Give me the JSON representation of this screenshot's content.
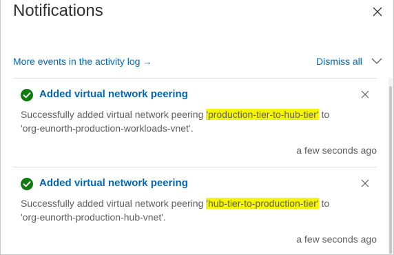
{
  "panel": {
    "title": "Notifications",
    "activity_log_link": "More events in the activity log",
    "activity_log_arrow": "→",
    "dismiss_all": "Dismiss all"
  },
  "colors": {
    "link": "#0067b8",
    "success": "#107c10",
    "highlight": "#f5f500"
  },
  "notifications": [
    {
      "icon": "success-check-icon",
      "title": "Added virtual network peering",
      "body_prefix": "Successfully added virtual network peering ",
      "peering_name": "'production-tier-to-hub-tier'",
      "body_middle": " to",
      "target_vnet": "'org-eunorth-production-workloads-vnet'.",
      "time": "a few seconds ago"
    },
    {
      "icon": "success-check-icon",
      "title": "Added virtual network peering",
      "body_prefix": "Successfully added virtual network peering ",
      "peering_name": "'hub-tier-to-production-tier'",
      "body_middle": " to",
      "target_vnet": "'org-eunorth-production-hub-vnet'.",
      "time": "a few seconds ago"
    }
  ]
}
